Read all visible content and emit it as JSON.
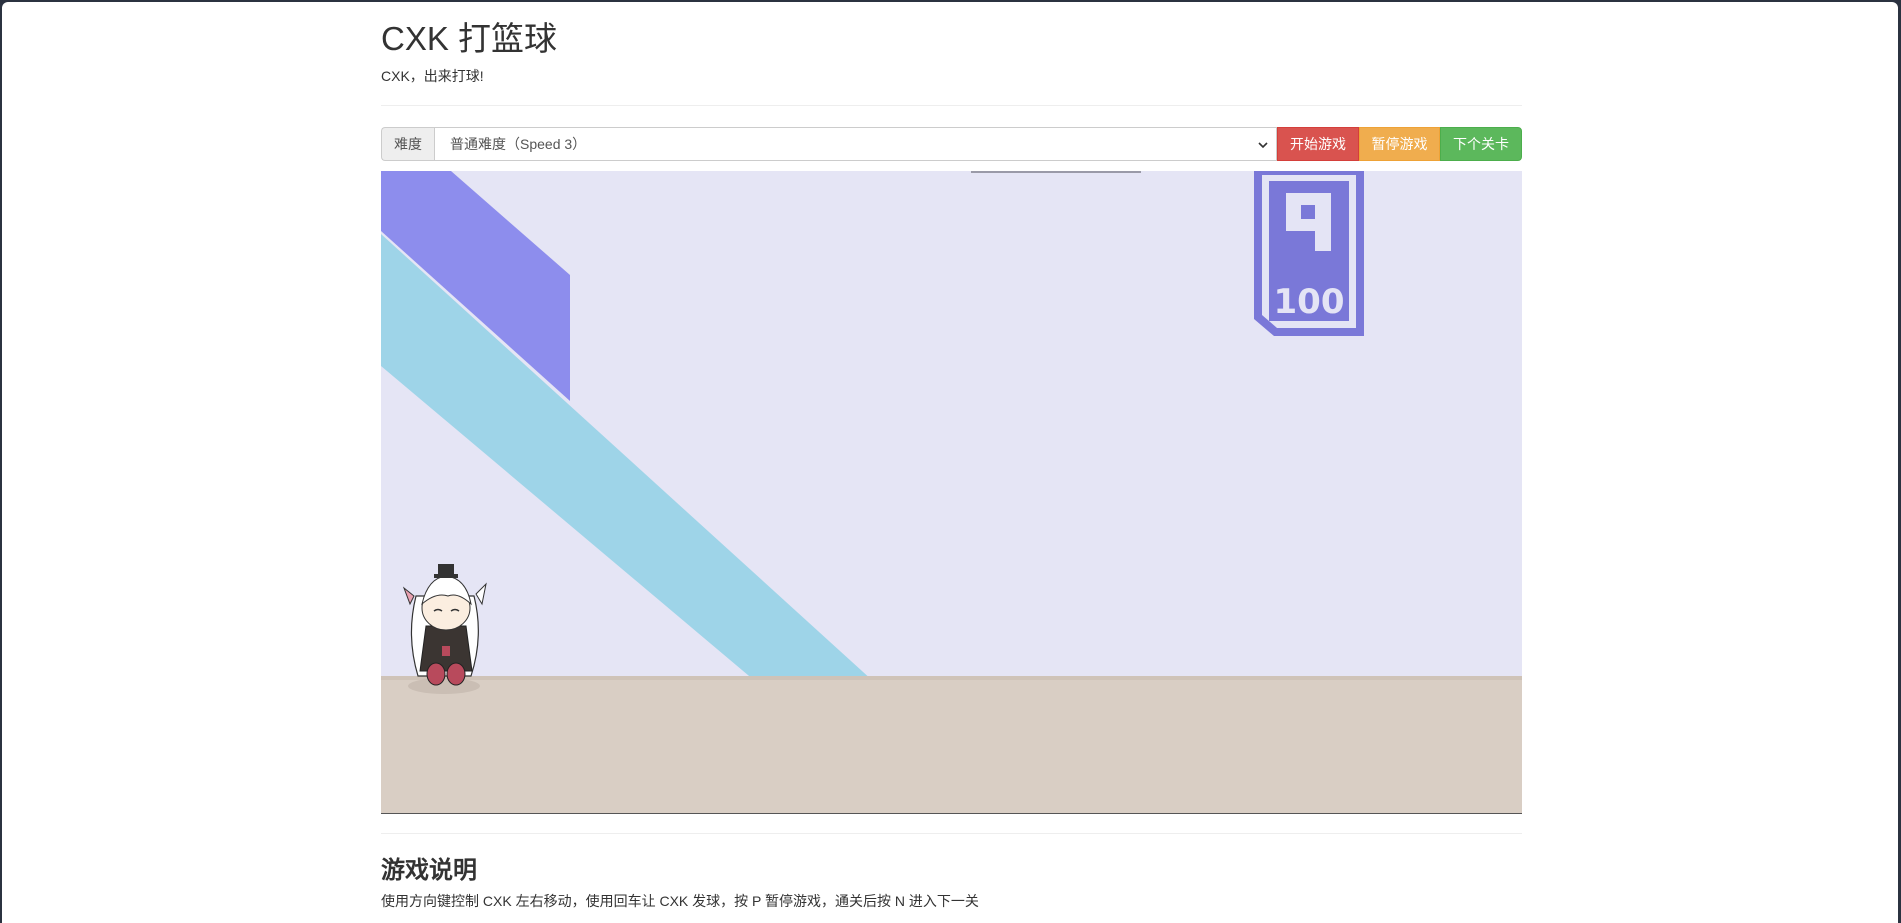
{
  "header": {
    "title": "CXK 打篮球",
    "subtitle": "CXK，出来打球!"
  },
  "controls": {
    "difficulty_label": "难度",
    "difficulty_selected": "普通难度（Speed 3）",
    "start_label": "开始游戏",
    "pause_label": "暂停游戏",
    "next_label": "下个关卡"
  },
  "game": {
    "scoreboard_number": "9",
    "scoreboard_sub": "100"
  },
  "instructions": {
    "title": "游戏说明",
    "line1": "使用方向键控制 CXK 左右移动，使用回车让 CXK 发球，按 P 暂停游戏，通关后按 N 进入下一关"
  },
  "colors": {
    "danger": "#d9534f",
    "warning": "#f0ad4e",
    "success": "#5cb85c",
    "stripe_purple": "#8d8ded",
    "stripe_teal": "#9ed4e8",
    "floor": "#d9cdc2"
  }
}
